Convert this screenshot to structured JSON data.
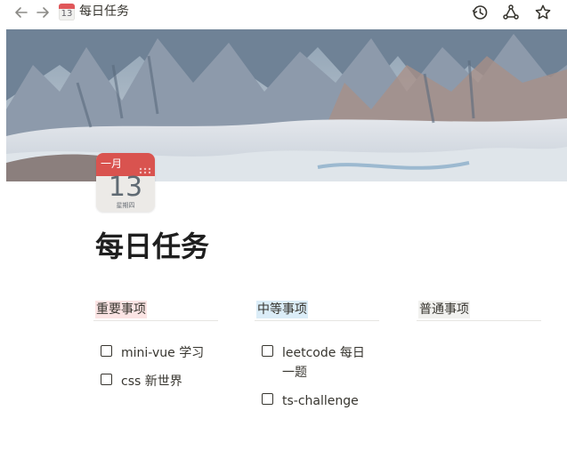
{
  "topbar": {
    "breadcrumb_title": "每日任务",
    "breadcrumb_icon_day": "13",
    "icons": [
      "back-arrow-icon",
      "forward-arrow-icon",
      "history-icon",
      "share-icon",
      "star-icon"
    ]
  },
  "page": {
    "icon": {
      "month": "一月",
      "day": "13",
      "weekday": "星期四",
      "accent_color": "#d9534f"
    },
    "title": "每日任务"
  },
  "columns": [
    {
      "title": "重要事项",
      "color": "#fbe4e4",
      "items": [
        {
          "text": "mini-vue 学习",
          "checked": false
        },
        {
          "text": "css 新世界",
          "checked": false
        }
      ]
    },
    {
      "title": "中等事项",
      "color": "#dbedf8",
      "items": [
        {
          "text": "leetcode 每日一题",
          "checked": false
        },
        {
          "text": "ts-challenge",
          "checked": false
        }
      ]
    },
    {
      "title": "普通事项",
      "color": "#f1f1ef",
      "items": []
    }
  ]
}
